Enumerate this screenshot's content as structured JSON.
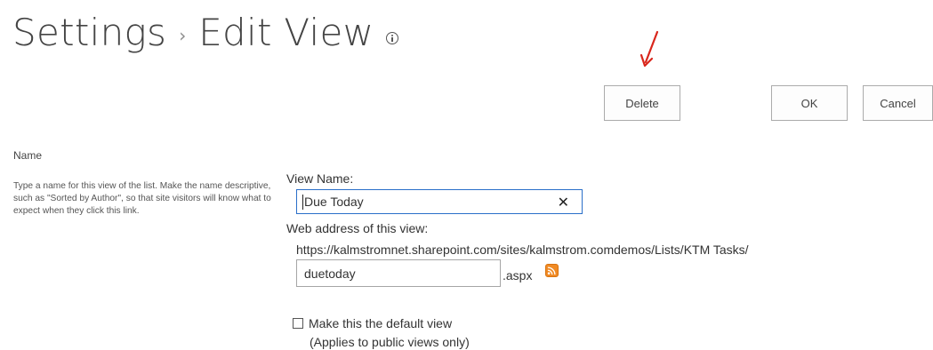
{
  "header": {
    "title_parent": "Settings",
    "breadcrumb_separator": "›",
    "title_current": "Edit View"
  },
  "actions": {
    "delete_label": "Delete",
    "ok_label": "OK",
    "cancel_label": "Cancel"
  },
  "name_section": {
    "heading": "Name",
    "description": "Type a name for this view of the list. Make the name descriptive, such as \"Sorted by Author\", so that site visitors will know what to expect when they click this link."
  },
  "view_name": {
    "label": "View Name:",
    "value": "Due Today"
  },
  "web_address": {
    "label": "Web address of this view:",
    "base_url": "https://kalmstromnet.sharepoint.com/sites/kalmstrom.comdemos/Lists/KTM Tasks/",
    "page_value": "duetoday",
    "extension": ".aspx"
  },
  "default_view": {
    "checked": false,
    "label": "Make this the default view",
    "note": "(Applies to public views only)"
  },
  "colors": {
    "annotation_arrow": "#d9261c",
    "rss_orange": "#f08a24",
    "input_focus_border": "#2a6fc9"
  },
  "icons": {
    "info": "info-icon",
    "clear": "clear-x-icon",
    "rss": "rss-icon",
    "annotation": "red-arrow-annotation"
  }
}
